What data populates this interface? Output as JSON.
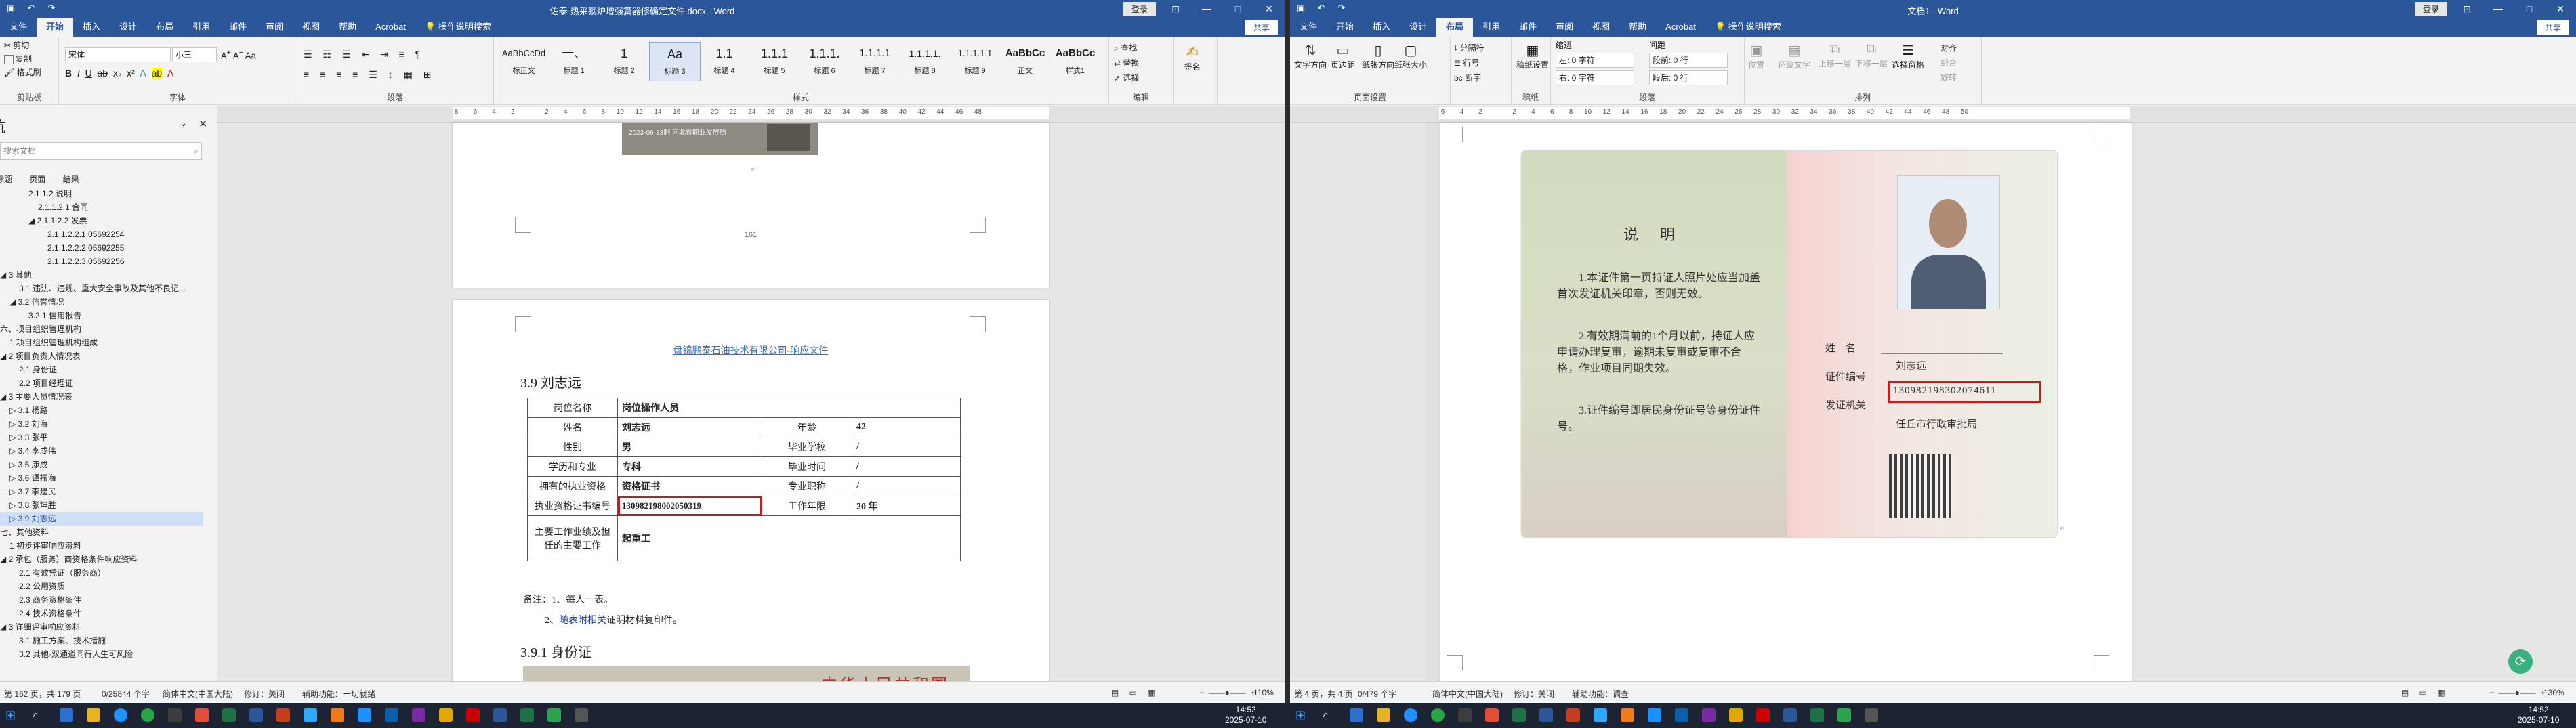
{
  "left_window": {
    "title": "佐泰-热采钢炉增强篇器修确定文件.docx - Word",
    "sign_in": "登录",
    "share": "共享",
    "tabs": [
      "文件",
      "开始",
      "插入",
      "设计",
      "布局",
      "引用",
      "邮件",
      "审阅",
      "视图",
      "帮助",
      "Acrobat",
      "操作说明搜索"
    ],
    "active_tab": "开始",
    "clipboard": {
      "cut": "剪切",
      "copy": "复制",
      "paste": "粘贴",
      "format_painter": "格式刷",
      "label": "剪贴板"
    },
    "font": {
      "name": "宋体",
      "size": "小三",
      "label": "字体"
    },
    "paragraph_label": "段落",
    "styles": [
      {
        "preview": "AaBbCcDd",
        "name": "标正文"
      },
      {
        "preview": "一、",
        "name": "标题 1"
      },
      {
        "preview": "1",
        "name": "标题 2"
      },
      {
        "preview": "Aa",
        "name": "标题 3"
      },
      {
        "preview": "1.1",
        "name": "标题 4"
      },
      {
        "preview": "1.1.1",
        "name": "标题 5"
      },
      {
        "preview": "1.1.1.",
        "name": "标题 6"
      },
      {
        "preview": "1.1.1.1",
        "name": "标题 7"
      },
      {
        "preview": "1.1.1.1.",
        "name": "标题 8"
      },
      {
        "preview": "1.1.1.1.1",
        "name": "标题 9"
      },
      {
        "preview": "AaBbCc",
        "name": "正文"
      },
      {
        "preview": "AaBbCc",
        "name": "样式1"
      }
    ],
    "styles_label": "样式",
    "editing": {
      "find": "查找",
      "replace": "替换",
      "select": "选择",
      "label": "编辑"
    },
    "sign_btn": {
      "label": "签名",
      "group": "签名"
    },
    "nav": {
      "title": "导航",
      "search_placeholder": "搜索文档",
      "tabs": [
        "标题",
        "页面",
        "结果"
      ],
      "items": [
        {
          "text": "2.1.1.2 说明",
          "indent": 3
        },
        {
          "text": "2.1.1.2.1 合同",
          "indent": 4
        },
        {
          "text": "◢ 2.1.1.2.2 发票",
          "indent": 3
        },
        {
          "text": "2.1.1.2.2.1 05692254",
          "indent": 5
        },
        {
          "text": "2.1.1.2.2.2 05692255",
          "indent": 5
        },
        {
          "text": "2.1.1.2.2.3 05692256",
          "indent": 5
        },
        {
          "text": "◢ 3 其他",
          "indent": 0
        },
        {
          "text": "3.1 违法、违规、重大安全事故及其他不良记...",
          "indent": 2
        },
        {
          "text": "◢ 3.2 信誉情况",
          "indent": 1
        },
        {
          "text": "3.2.1 信用报告",
          "indent": 3
        },
        {
          "text": "六、项目组织管理机构",
          "indent": 0
        },
        {
          "text": "1 项目组织管理机构组成",
          "indent": 1
        },
        {
          "text": "◢ 2 项目负责人情况表",
          "indent": 0
        },
        {
          "text": "2.1 身份证",
          "indent": 2
        },
        {
          "text": "2.2 项目经理证",
          "indent": 2
        },
        {
          "text": "◢ 3 主要人员情况表",
          "indent": 0
        },
        {
          "text": "▷ 3.1 杨路",
          "indent": 1
        },
        {
          "text": "▷ 3.2 刘海",
          "indent": 1
        },
        {
          "text": "▷ 3.3 张平",
          "indent": 1
        },
        {
          "text": "▷ 3.4 李成伟",
          "indent": 1
        },
        {
          "text": "▷ 3.5 康成",
          "indent": 1
        },
        {
          "text": "▷ 3.6 谭振海",
          "indent": 1
        },
        {
          "text": "▷ 3.7 李建民",
          "indent": 1
        },
        {
          "text": "▷ 3.8 张坤胜",
          "indent": 1
        },
        {
          "text": "▷ 3.9 刘志远",
          "indent": 1,
          "selected": true
        },
        {
          "text": "七、其他资料",
          "indent": 0
        },
        {
          "text": "1 初步评审响应资料",
          "indent": 1
        },
        {
          "text": "◢ 2 承包（服务）商资格条件响应资料",
          "indent": 0
        },
        {
          "text": "2.1 有效凭证（服务商）",
          "indent": 2
        },
        {
          "text": "2.2 公用资质",
          "indent": 2
        },
        {
          "text": "2.3 商务资格条件",
          "indent": 2
        },
        {
          "text": "2.4 技术资格条件",
          "indent": 2
        },
        {
          "text": "◢ 3 详细评审响应资料",
          "indent": 0
        },
        {
          "text": "3.1 施工方案、技术措施",
          "indent": 2
        },
        {
          "text": "3.2 其他·双通道同行人生可风险",
          "indent": 2
        }
      ]
    },
    "doc": {
      "page_top_photo_caption": "2023-06-13制  河北省职业发展局",
      "page_number": "161",
      "header_link": "盘锦鹏泰石油技术有限公司-响应文件",
      "section_heading": "3.9    刘志远",
      "table": [
        {
          "c1": "岗位名称",
          "c2": "岗位操作人员",
          "c3": "",
          "c4": ""
        },
        {
          "c1": "姓名",
          "c2": "刘志远",
          "c3": "年龄",
          "c4": "42"
        },
        {
          "c1": "性别",
          "c2": "男",
          "c3": "毕业学校",
          "c4": "/"
        },
        {
          "c1": "学历和专业",
          "c2": "专科",
          "c3": "毕业时间",
          "c4": "/"
        },
        {
          "c1": "拥有的执业资格",
          "c2": "资格证书",
          "c3": "专业职称",
          "c4": "/"
        },
        {
          "c1": "执业资格证书编号",
          "c2": "130982198002050319",
          "c3": "工作年限",
          "c4": "20 年"
        },
        {
          "c1": "主要工作业绩及担任的主要工作",
          "c2": "起重工",
          "c3": "",
          "c4": ""
        }
      ],
      "note_line1": "备注：1、每人一表。",
      "note_line2_link": "随表附相关",
      "note_line2_rest": "证明材料复印件。",
      "sub_heading": "3.9.1  身份证",
      "id_card_text": "中华人民共和国"
    },
    "status": {
      "page": "第 162 页，共 179 页",
      "words": "0/25844 个字",
      "lang": "简体中文(中国大陆)",
      "track": "修订：关闭",
      "access": "辅助功能：一切就绪",
      "zoom": "110%"
    }
  },
  "right_window": {
    "title": "文档1 - Word",
    "sign_in": "登录",
    "share": "共享",
    "tabs": [
      "文件",
      "开始",
      "插入",
      "设计",
      "布局",
      "引用",
      "邮件",
      "审阅",
      "视图",
      "帮助",
      "Acrobat",
      "操作说明搜索"
    ],
    "active_tab": "布局",
    "page_setup": {
      "buttons": [
        "文字方向",
        "页边距",
        "纸张方向",
        "纸张大小"
      ],
      "label": "页面设置"
    },
    "page_setup_small": [
      "分隔符",
      "行号",
      "断字"
    ],
    "draft": {
      "label": "稿纸设置",
      "group": "稿纸"
    },
    "indent": {
      "label": "缩进",
      "left": "左: 0 字符",
      "right": "右: 0 字符"
    },
    "spacing": {
      "label": "间距",
      "before": "段前: 0 行",
      "after": "段后: 0 行"
    },
    "para_label": "段落",
    "arrange": {
      "buttons": [
        "位置",
        "环绕文字",
        "上移一层",
        "下移一层",
        "选择窗格"
      ],
      "small": [
        "对齐",
        "组合",
        "旋转"
      ],
      "label": "排列"
    },
    "card": {
      "title": "说    明",
      "p1": "1.本证件第一页持证人照片处应当加盖首次发证机关印章，否则无效。",
      "p2": "2.有效期满前的1个月以前，持证人应申请办理复审，逾期未复审或复审不合格，作业项目同期失效。",
      "p3": "3.证件编号即居民身份证号等身份证件号。",
      "name_label": "姓    名",
      "name_value": "刘志远",
      "cert_label": "证件编号",
      "cert_value": "130982198302074611",
      "org_label": "发证机关",
      "org_value": "任丘市行政审批局"
    },
    "status": {
      "page": "第 4 页，共 4 页",
      "words": "0/479 个字",
      "lang": "简体中文(中国大陆)",
      "track": "修订：关闭",
      "access": "辅助功能：调查",
      "zoom": "130%"
    }
  },
  "taskbar": {
    "left_tray": {
      "time": "14:52",
      "date": "2025-07-10"
    },
    "right_tray": {
      "time": "14:52",
      "date": "2025-07-10"
    }
  }
}
